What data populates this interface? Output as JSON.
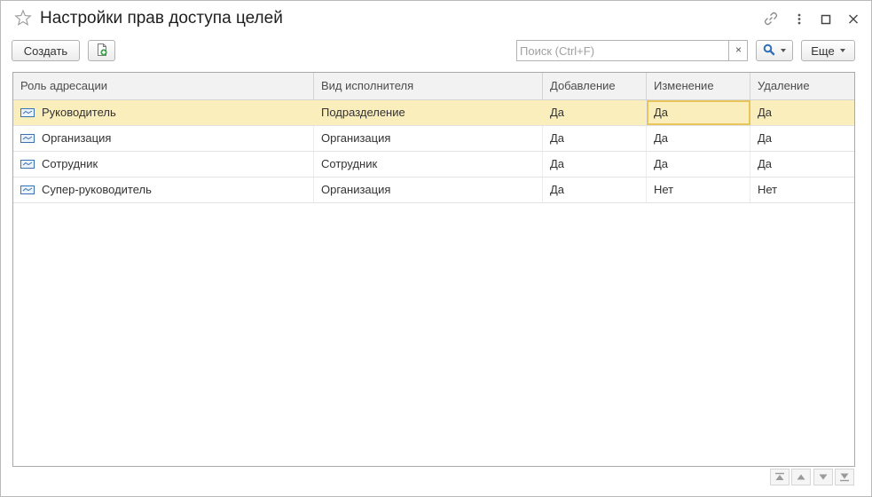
{
  "window": {
    "title": "Настройки прав доступа целей"
  },
  "toolbar": {
    "create_label": "Создать",
    "search_placeholder": "Поиск (Ctrl+F)",
    "search_value": "",
    "search_clear": "×",
    "more_label": "Еще"
  },
  "table": {
    "headers": [
      "Роль адресации",
      "Вид исполнителя",
      "Добавление",
      "Изменение",
      "Удаление"
    ],
    "rows": [
      [
        "Руководитель",
        "Подразделение",
        "Да",
        "Да",
        "Да"
      ],
      [
        "Организация",
        "Организация",
        "Да",
        "Да",
        "Да"
      ],
      [
        "Сотрудник",
        "Сотрудник",
        "Да",
        "Да",
        "Да"
      ],
      [
        "Супер-руководитель",
        "Организация",
        "Да",
        "Нет",
        "Нет"
      ]
    ]
  },
  "icons": {
    "favorite": "star-icon",
    "link": "link-icon",
    "more": "more-vertical-icon",
    "maximize": "maximize-icon",
    "close": "close-icon",
    "copy": "copy-add-icon",
    "search": "search-icon",
    "role": "role-icon"
  },
  "colors": {
    "selected_row": "#fbeebd",
    "current_cell_border": "#e8c45a",
    "header_bg": "#f2f2f2",
    "search_icon": "#2f6fb8"
  }
}
